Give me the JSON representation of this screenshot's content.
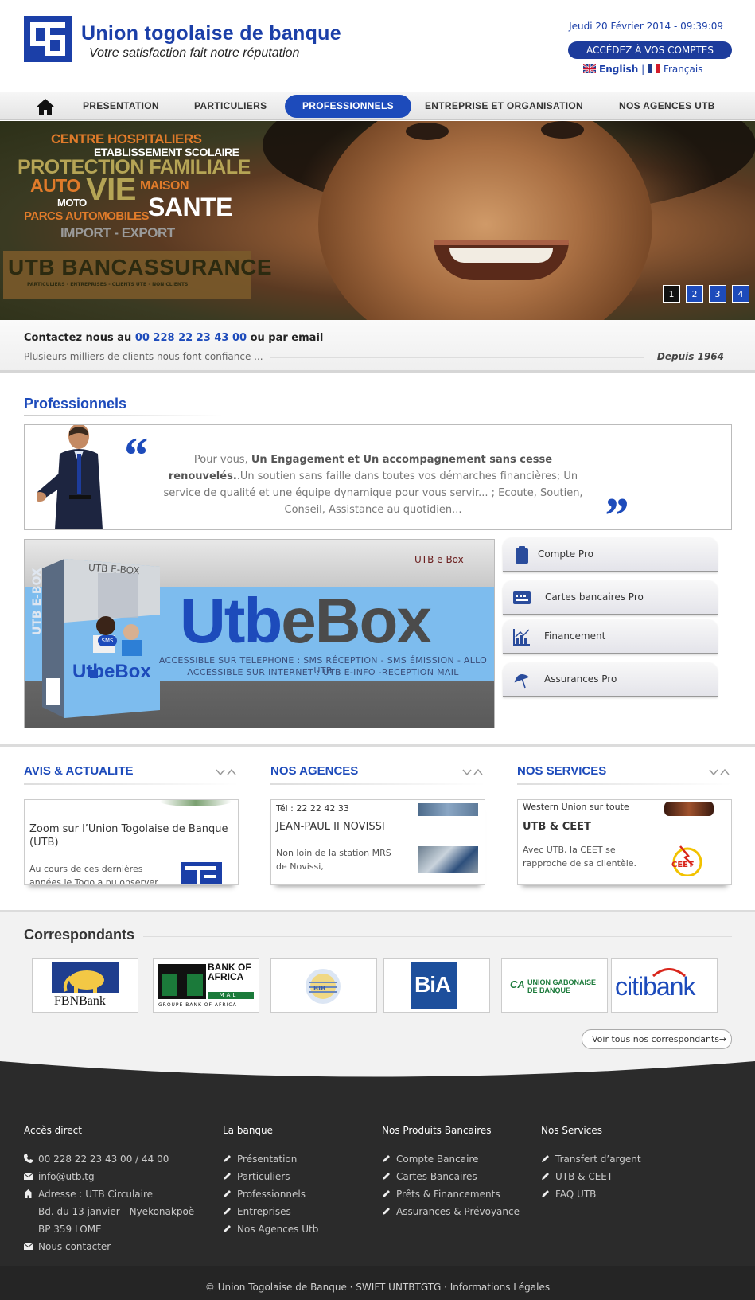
{
  "header": {
    "brand_name": "Union togolaise de banque",
    "brand_tagline": "Votre satisfaction fait notre réputation",
    "date": "Jeudi 20 Février 2014 - 09:39:09",
    "accounts_button": "ACCÉDEZ À VOS COMPTES",
    "lang_english": "English",
    "lang_separator": "|",
    "lang_french": "Français"
  },
  "nav": {
    "items": [
      {
        "label": "PRESENTATION"
      },
      {
        "label": "PARTICULIERS"
      },
      {
        "label": "PROFESSIONNELS",
        "active": true
      },
      {
        "label": "ENTREPRISE ET ORGANISATION"
      },
      {
        "label": "NOS AGENCES UTB"
      }
    ]
  },
  "hero": {
    "words": {
      "centre": "CENTRE HOSPITALIERS",
      "etab": "ETABLISSEMENT SCOLAIRE",
      "protection": "PROTECTION FAMILIALE",
      "auto": "AUTO",
      "vie": "VIE",
      "maison": "MAISON",
      "moto": "MOTO",
      "parcs": "PARCS AUTOMOBILES",
      "sante": "SANTE",
      "import": "IMPORT - EXPORT"
    },
    "banca_title": "UTB BANCASSURANCE",
    "banca_sub": "PARTICULIERS - ENTREPRISES - CLIENTS UTB - NON CLIENTS",
    "slides": [
      "1",
      "2",
      "3",
      "4"
    ],
    "active_slide": 1
  },
  "contact": {
    "prefix": "Contactez nous au",
    "phone": "00 228 22 23 43 00",
    "suffix": "ou par email",
    "subtitle": "Plusieurs milliers de clients nous font confiance ...",
    "since": "Depuis 1964"
  },
  "professionnels": {
    "title": "Professionnels",
    "quote_intro": "Pour vous,",
    "quote_bold": "Un Engagement et Un accompagnement sans cesse renouvelés.",
    "quote_rest": ".Un soutien sans faille dans toutes vos démarches financières; Un service de qualité et une équipe dynamique pour vous servir... ; Ecoute, Soutien, Conseil, Assistance au quotidien...",
    "open_quote": "“",
    "close_quote": "”"
  },
  "ebox": {
    "brand": "UTB e-Box",
    "logo_utb": "Utb",
    "logo_e": "e",
    "logo_box": "Box",
    "line1": "ACCESSIBLE SUR TELEPHONE : SMS RÉCEPTION - SMS ÉMISSION - ALLO UTB",
    "line2": "ACCESSIBLE SUR INTERNET : UTB E-INFO -RECEPTION MAIL",
    "pack_top": "UTB E-BOX",
    "pack_side": "UTB E-BOX",
    "pack_logo": "UtbeBox",
    "pack_badge": "SMS"
  },
  "pro_menu": [
    {
      "label": "Compte Pro",
      "icon": "clipboard-icon"
    },
    {
      "label": "Cartes bancaires Pro",
      "icon": "card-icon"
    },
    {
      "label": "Financement",
      "icon": "chart-icon"
    },
    {
      "label": "Assurances Pro",
      "icon": "umbrella-icon"
    }
  ],
  "columns": {
    "avis": {
      "title": "AVIS & ACTUALITE",
      "item_title": "Zoom sur l’Union Togolaise de Banque (UTB)",
      "item_text": "Au cours de ces dernières années le Togo a pu observer un"
    },
    "agences": {
      "title": "NOS AGENCES",
      "tel": "Tél : 22 22 42 33",
      "item_title": "JEAN-PAUL II NOVISSI",
      "item_text": "Non loin de la station MRS de Novissi,"
    },
    "services": {
      "title": "NOS SERVICES",
      "top_text": "Western Union sur toute",
      "item_title": "UTB & CEET",
      "item_text": "Avec UTB, la CEET se rapproche de sa clientèle.",
      "logo_text": "CEET"
    }
  },
  "correspondants": {
    "title": "Correspondants",
    "banks": [
      {
        "name": "FBNBank"
      },
      {
        "name": "BANK OF AFRICA",
        "sub": "MALI",
        "footer": "GROUPE BANK OF AFRICA"
      },
      {
        "name": "BIB"
      },
      {
        "name": "BiA"
      },
      {
        "name": "UNION GABONAISE DE BANQUE",
        "short": "CA"
      },
      {
        "name": "citibank"
      }
    ],
    "see_all": "Voir tous nos correspondants",
    "see_all_arrow": "→"
  },
  "footer": {
    "acces": {
      "title": "Accès direct",
      "phone": "00 228 22 23 43 00 / 44 00",
      "email": "info@utb.tg",
      "address1": "Adresse : UTB Circulaire",
      "address2": "Bd. du 13 janvier - Nyekonakpoè",
      "address3": "BP 359 LOME",
      "contact": "Nous contacter"
    },
    "banque": {
      "title": "La banque",
      "items": [
        "Présentation",
        "Particuliers",
        "Professionnels",
        "Entreprises",
        "Nos Agences Utb"
      ]
    },
    "produits": {
      "title": "Nos Produits Bancaires",
      "items": [
        "Compte Bancaire",
        "Cartes Bancaires",
        "Prêts & Financements",
        "Assurances & Prévoyance"
      ]
    },
    "services": {
      "title": "Nos Services",
      "items": [
        "Transfert d’argent",
        "UTB & CEET",
        "FAQ UTB"
      ]
    },
    "copyright": "© Union Togolaise de Banque · SWIFT UNTBTGTG · Informations Légales"
  },
  "colors": {
    "brand_blue": "#1d4bbb",
    "dark_blue": "#1d3c9c",
    "footer_bg": "#2b2b2b"
  }
}
